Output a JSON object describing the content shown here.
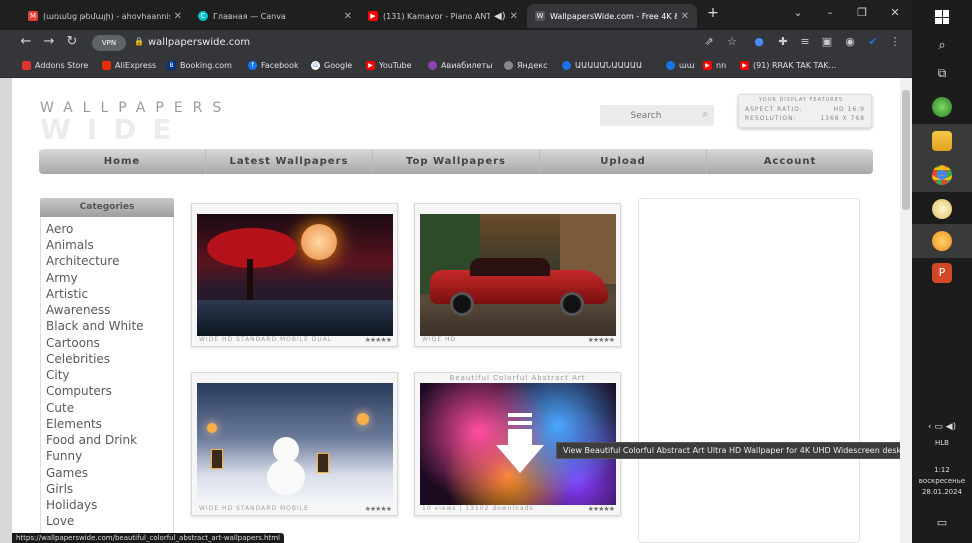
{
  "tabs": [
    {
      "title": "(առանց թեմայի) - ahovhaannis",
      "favicon": "M",
      "color": "#e44134"
    },
    {
      "title": "Главная — Canva",
      "favicon": "C",
      "color": "#00c4cc"
    },
    {
      "title": "(131) Kamavor - Piano ANT",
      "favicon": "▶",
      "color": "#ff0000"
    },
    {
      "title": "WallpapersWide.com - Free 4K &",
      "favicon": "W",
      "color": "#555555"
    }
  ],
  "address": {
    "vpn": "VPN",
    "url": "wallpaperswide.com"
  },
  "bookmarks": [
    {
      "label": "Addons Store",
      "color": "#d33"
    },
    {
      "label": "AliExpress",
      "color": "#e62e04"
    },
    {
      "label": "Booking.com",
      "color": "#003580"
    },
    {
      "label": "Facebook",
      "color": "#1877f2"
    },
    {
      "label": "Google",
      "color": "#4285f4"
    },
    {
      "label": "YouTube",
      "color": "#ff0000"
    },
    {
      "label": "Авиабилеты",
      "color": "#8e44ad"
    },
    {
      "label": "Яндекс",
      "color": "#888888"
    },
    {
      "label": "ԱԱԱԱԱՆԱԱԱԱԱ",
      "color": "#1a73e8"
    },
    {
      "label": "աա",
      "color": "#1a73e8"
    },
    {
      "label": "nn",
      "color": "#ff0000"
    },
    {
      "label": "(91) RRAK TAK TAK...",
      "color": "#ff0000"
    }
  ],
  "site": {
    "logo_top": "WALLPAPERS",
    "logo_bottom": "WIDE",
    "search_placeholder": "Search",
    "display_features": {
      "heading": "YOUR DISPLAY FEATURES",
      "aspect_label": "ASPECT RATIO:",
      "aspect_value": "HD 16:9",
      "resolution_label": "RESOLUTION:",
      "resolution_value": "1366 X 768"
    },
    "menu": [
      "Home",
      "Latest Wallpapers",
      "Top Wallpapers",
      "Upload",
      "Account"
    ],
    "categories_title": "Categories",
    "categories": [
      "Aero",
      "Animals",
      "Architecture",
      "Army",
      "Artistic",
      "Awareness",
      "Black and White",
      "Cartoons",
      "Celebrities",
      "City",
      "Computers",
      "Cute",
      "Elements",
      "Food and Drink",
      "Funny",
      "Games",
      "Girls",
      "Holidays",
      "Love"
    ],
    "thumbnails": [
      {
        "caption": "",
        "tags": "WIDE HD STANDARD MOBILE DUAL",
        "stars": "★★★★★"
      },
      {
        "caption": "",
        "tags": "WIDE HD",
        "stars": "★★★★★"
      },
      {
        "caption": "",
        "tags": "WIDE HD STANDARD MOBILE",
        "stars": "★★★★★"
      },
      {
        "caption": "Beautiful Colorful Abstract Art",
        "tags": "10 views | 13102 downloads",
        "stars": "★★★★★"
      }
    ]
  },
  "tooltip": "View Beautiful Colorful Abstract Art Ultra HD Wallpaper for 4K UHD Widescreen desktop, tablet & smartphone",
  "status_url": "https://wallpaperswide.com/beautiful_colorful_abstract_art-wallpapers.html",
  "clock": {
    "lang": "HLB",
    "time": "1:12",
    "day": "воскресенье",
    "date": "28.01.2024"
  }
}
